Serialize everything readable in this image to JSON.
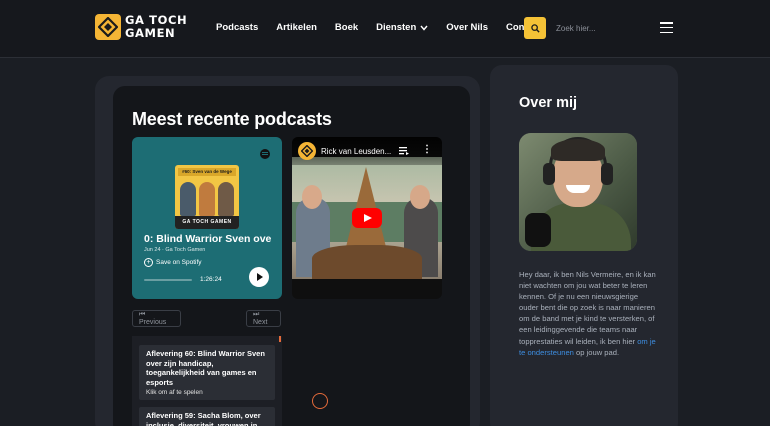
{
  "brand": {
    "logo_line1": "GA TOCH",
    "logo_line2": "GAMEN"
  },
  "nav": {
    "items": [
      "Podcasts",
      "Artikelen",
      "Boek"
    ],
    "dropdown": "Diensten",
    "items_after": [
      "Over Nils",
      "Contact"
    ]
  },
  "search": {
    "placeholder": "Zoek hier..."
  },
  "podcasts": {
    "title": "Meest recente podcasts",
    "spotify": {
      "cover_title": "#60: Sven van de Wege",
      "cover_brand": "GA TOCH GAMEN",
      "episode_title": "0: Blind Warrior Sven ove",
      "meta": "Jun 24 · Ga Toch Gamen",
      "save_label": "Save on Spotify",
      "duration": "1:26:24",
      "progress": 0
    },
    "youtube": {
      "title": "Rick van Leusden..."
    },
    "pagination": {
      "prev": "⏮ Previous",
      "next": "⏭ Next"
    },
    "episodes": [
      {
        "title": "Aflevering 60: Blind Warrior Sven over zijn handicap, toegankelijkheid van games en esports",
        "subtitle": "Klik om af te spelen"
      },
      {
        "title": "Aflevering 59: Sacha Blom, over inclusie, diversiteit, vrouwen in",
        "subtitle": ""
      }
    ]
  },
  "about": {
    "title": "Over mij",
    "bio_before": "Hey daar, ik ben Nils Vermeire, en ik kan niet wachten om jou wat beter te leren kennen. Of je nu een nieuwsgierige ouder bent die op zoek is naar manieren om de band met je kind te versterken, of een leidinggevende die teams naar topprestaties wil leiden, ik ben hier ",
    "bio_link": "om je te ondersteunen",
    "bio_after": " op jouw pad."
  },
  "colors": {
    "accent": "#f5c236",
    "background": "#1b1e24",
    "panel": "#24272f",
    "link": "#3d8de0",
    "spotify": "#1d6d74"
  }
}
